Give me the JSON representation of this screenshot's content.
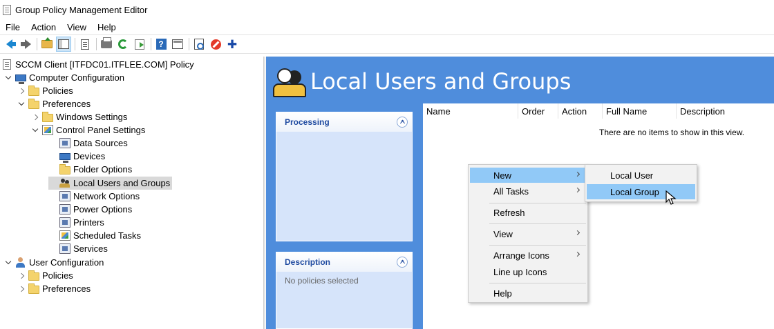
{
  "window": {
    "title": "Group Policy Management Editor"
  },
  "menubar": {
    "items": [
      "File",
      "Action",
      "View",
      "Help"
    ]
  },
  "toolbar": {
    "icons": [
      "back-icon",
      "forward-icon",
      "up-folder-icon",
      "show-hide-tree-icon",
      "properties-doc-icon",
      "print-icon",
      "refresh-icon",
      "export-list-icon",
      "help-icon",
      "action-pane-icon",
      "properties-icon",
      "stop-icon",
      "add-icon"
    ]
  },
  "tree": {
    "root": "SCCM Client [ITFDC01.ITFLEE.COM] Policy",
    "computer_config": "Computer Configuration",
    "policies": "Policies",
    "preferences": "Preferences",
    "windows_settings": "Windows Settings",
    "control_panel_settings": "Control Panel Settings",
    "data_sources": "Data Sources",
    "devices": "Devices",
    "folder_options": "Folder Options",
    "local_users_groups": "Local Users and Groups",
    "network_options": "Network Options",
    "power_options": "Power Options",
    "printers": "Printers",
    "scheduled_tasks": "Scheduled Tasks",
    "services": "Services",
    "user_config": "User Configuration",
    "user_policies": "Policies",
    "user_preferences": "Preferences"
  },
  "banner": {
    "title": "Local Users and Groups"
  },
  "cards": {
    "processing": {
      "title": "Processing"
    },
    "description": {
      "title": "Description",
      "body": "No policies selected"
    }
  },
  "listview": {
    "columns": [
      "Name",
      "Order",
      "Action",
      "Full Name",
      "Description"
    ],
    "empty": "There are no items to show in this view."
  },
  "context_menu": {
    "new": "New",
    "all_tasks": "All Tasks",
    "refresh": "Refresh",
    "view": "View",
    "arrange_icons": "Arrange Icons",
    "line_up_icons": "Line up Icons",
    "help": "Help"
  },
  "submenu": {
    "local_user": "Local User",
    "local_group": "Local Group"
  },
  "colors": {
    "panel_blue": "#4f8ddc",
    "card_bg": "#d6e4fa",
    "menu_highlight": "#91c9f7",
    "card_title": "#1f4aa0"
  }
}
